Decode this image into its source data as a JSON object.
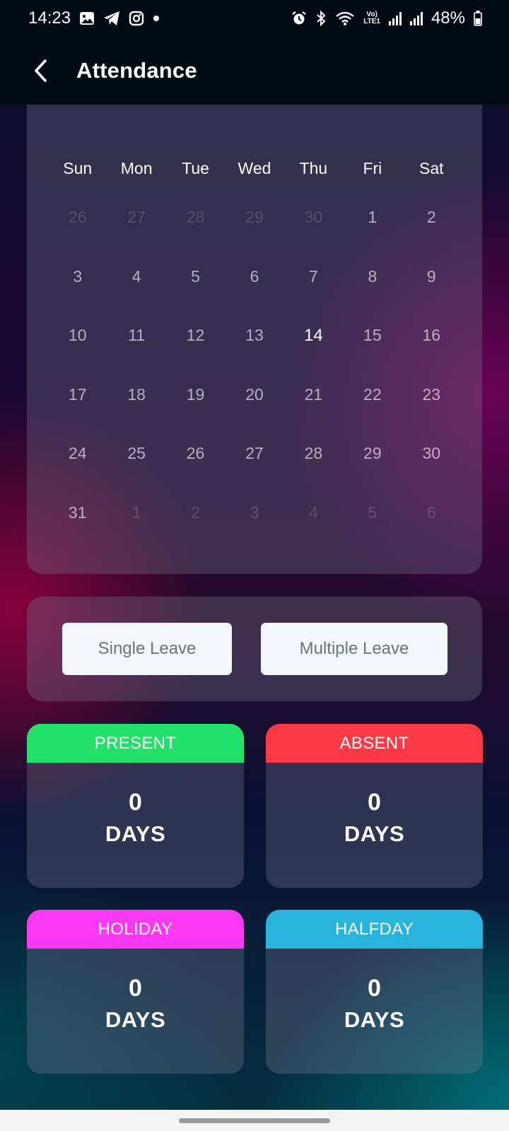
{
  "status_bar": {
    "time": "14:23",
    "lte_top": "Vo)",
    "lte_bottom": "LTE1",
    "battery": "48%"
  },
  "header": {
    "title": "Attendance"
  },
  "calendar": {
    "weekdays": [
      "Sun",
      "Mon",
      "Tue",
      "Wed",
      "Thu",
      "Fri",
      "Sat"
    ],
    "weeks": [
      [
        "26",
        "27",
        "28",
        "29",
        "30",
        "1",
        "2"
      ],
      [
        "3",
        "4",
        "5",
        "6",
        "7",
        "8",
        "9"
      ],
      [
        "10",
        "11",
        "12",
        "13",
        "14",
        "15",
        "16"
      ],
      [
        "17",
        "18",
        "19",
        "20",
        "21",
        "22",
        "23"
      ],
      [
        "24",
        "25",
        "26",
        "27",
        "28",
        "29",
        "30"
      ],
      [
        "31",
        "1",
        "2",
        "3",
        "4",
        "5",
        "6"
      ]
    ]
  },
  "leave": {
    "single_label": "Single Leave",
    "multiple_label": "Multiple Leave"
  },
  "stats": {
    "present": {
      "label": "PRESENT",
      "value": "0",
      "unit": "DAYS",
      "color": "#22e06a"
    },
    "absent": {
      "label": "ABSENT",
      "value": "0",
      "unit": "DAYS",
      "color": "#fb3a45"
    },
    "holiday": {
      "label": "HOLIDAY",
      "value": "0",
      "unit": "DAYS",
      "color": "#fb38f3"
    },
    "halfday": {
      "label": "HALFDAY",
      "value": "0",
      "unit": "DAYS",
      "color": "#28b4da"
    }
  }
}
